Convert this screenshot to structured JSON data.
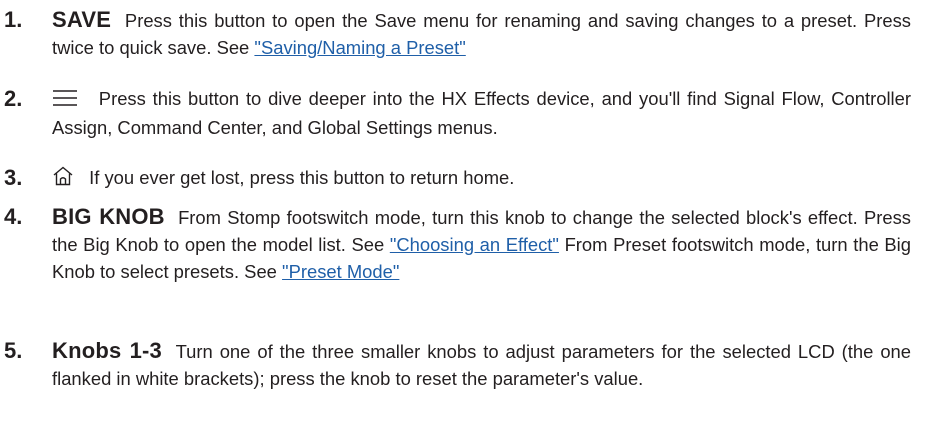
{
  "items": [
    {
      "number": "1.",
      "title": "SAVE",
      "text_a": "Press this button to open the Save menu for renaming and saving changes to a preset. Press twice to quick save. See",
      "link_a": "\"Saving/Naming a Preset\""
    },
    {
      "number": "2.",
      "icon": "menu-lines-icon",
      "text_a": "Press this button to dive deeper into the HX Effects device, and you'll find Signal Flow, Controller Assign, Command Center, and Global Settings menus."
    },
    {
      "number": "3.",
      "icon": "home-icon",
      "text_a": "If you ever get lost, press this button to return home."
    },
    {
      "number": "4.",
      "title": "BIG KNOB",
      "text_a": "From Stomp footswitch mode, turn this knob to change the selected block's effect. Press the Big Knob to open the model list. See",
      "link_a": "\"Choosing an Effect\"",
      "text_b": "From Preset footswitch mode, turn the Big Knob to select presets. See",
      "link_b": "\"Preset Mode\""
    },
    {
      "number": "5.",
      "title": "Knobs 1-3",
      "text_a": "Turn one of the three smaller knobs to adjust parameters for the selected LCD (the one flanked in white brackets); press the knob to reset the parameter's value."
    }
  ],
  "colors": {
    "text": "#231f20",
    "link": "#1f5fa8"
  }
}
